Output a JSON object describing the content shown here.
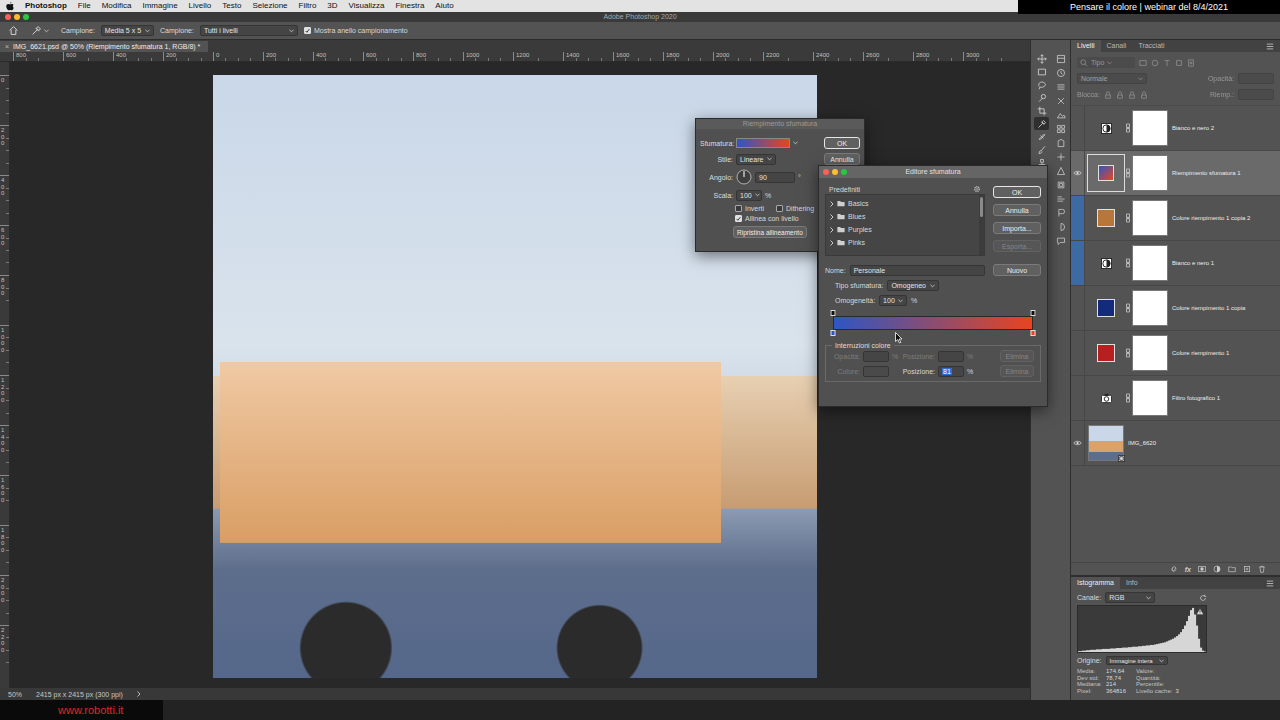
{
  "menubar": {
    "items": [
      {
        "label": "Photoshop",
        "bold": true
      },
      {
        "label": "File",
        "bold": false
      },
      {
        "label": "Modifica",
        "bold": false
      },
      {
        "label": "Immagine",
        "bold": false
      },
      {
        "label": "Livello",
        "bold": false
      },
      {
        "label": "Testo",
        "bold": false
      },
      {
        "label": "Selezione",
        "bold": false
      },
      {
        "label": "Filtro",
        "bold": false
      },
      {
        "label": "3D",
        "bold": false
      },
      {
        "label": "Visualizza",
        "bold": false
      },
      {
        "label": "Finestra",
        "bold": false
      },
      {
        "label": "Aiuto",
        "bold": false
      }
    ],
    "banner": "Pensare il colore | webinar del 8/4/2021"
  },
  "window": {
    "title": "Adobe Photoshop 2020"
  },
  "options_bar": {
    "sample_size_label": "Campione:",
    "sample_size": "Media 5 x 5",
    "sample_label": "Campione:",
    "sample": "Tutti i livelli",
    "ring": {
      "label": "Mostra anello campionamento",
      "checked": true
    }
  },
  "document": {
    "tab": {
      "close": "×",
      "title": "IMG_6621.psd @ 50% (Riempimento sfumatura 1, RGB/8) *",
      "selected": true
    },
    "rulers": {
      "top": [
        "800",
        "600",
        "400",
        "200",
        "0",
        "200",
        "400",
        "600",
        "800",
        "1000",
        "1200",
        "1400",
        "1600",
        "1800",
        "2000",
        "2200",
        "2400",
        "2600",
        "2800",
        "3000"
      ],
      "left": [
        "0",
        "200",
        "400",
        "600",
        "800",
        "1000",
        "1200",
        "1400",
        "1600",
        "1800",
        "2000",
        "2200"
      ]
    },
    "status": {
      "zoom": "50%",
      "size": "2415 px x 2415 px (300 ppi)"
    }
  },
  "watermark": "www.robotti.it",
  "tools": [
    {
      "selected": false
    },
    {
      "selected": false
    },
    {
      "selected": false
    },
    {
      "selected": false
    },
    {
      "selected": false
    },
    {
      "selected": true
    },
    {
      "selected": false
    },
    {
      "selected": false
    },
    {
      "selected": false
    },
    {
      "selected": false
    },
    {
      "selected": false
    },
    {
      "selected": false
    },
    {
      "selected": false
    },
    {
      "selected": false
    },
    {
      "selected": false
    },
    {
      "selected": false
    },
    {
      "selected": false
    },
    {
      "selected": false
    },
    {
      "selected": false
    },
    {
      "selected": false
    }
  ],
  "fill_dialog": {
    "title": "Riempimento sfumatura",
    "active": false,
    "gradient_label": "Sfumatura:",
    "style_label": "Stile:",
    "style": "Lineare",
    "angle_label": "Angolo:",
    "angle": "90",
    "angle_unit": "°",
    "scale_label": "Scala:",
    "scale": "100",
    "scale_unit": "%",
    "checkboxes": [
      {
        "label": "Inverti",
        "checked": false
      },
      {
        "label": "Dithering",
        "checked": false
      },
      {
        "label": "Allinea con livello",
        "checked": true
      }
    ],
    "reset_button": "Ripristina allineamento",
    "buttons": [
      {
        "label": "OK",
        "default": true
      },
      {
        "label": "Annulla",
        "default": false
      }
    ]
  },
  "gradient_editor": {
    "title": "Editore sfumatura",
    "active": true,
    "presets_label": "Predefiniti",
    "folders": [
      {
        "label": "Basics",
        "expanded": false
      },
      {
        "label": "Blues",
        "expanded": false
      },
      {
        "label": "Purples",
        "expanded": false
      },
      {
        "label": "Pinks",
        "expanded": false
      }
    ],
    "buttons": [
      {
        "label": "OK",
        "default": true,
        "disabled": false
      },
      {
        "label": "Annulla",
        "default": false,
        "disabled": false
      },
      {
        "label": "Importa...",
        "default": false,
        "disabled": false
      },
      {
        "label": "Esporta...",
        "default": false,
        "disabled": true
      }
    ],
    "name_label": "Nome:",
    "name": "Personale",
    "new_button": "Nuovo",
    "type_label": "Tipo sfumatura:",
    "type": "Omogeneo",
    "smoothness_label": "Omogeneità:",
    "smoothness": "100",
    "smoothness_unit": "%",
    "opacity_stops": [
      {
        "location": 0,
        "selected": false
      },
      {
        "location": 1,
        "selected": false
      }
    ],
    "color_stops": [
      {
        "location": 0,
        "color": "#2e56c4",
        "selected": false
      },
      {
        "location": 1,
        "color": "#e8441f",
        "selected": false
      }
    ],
    "stops_group": {
      "title": "Interruzioni colore",
      "opacity_row": {
        "label": "Opacità:",
        "value": "",
        "unit": "%",
        "position_label": "Posizione:",
        "position": "",
        "position_unit": "%",
        "delete": "Elimina",
        "disabled": true
      },
      "color_row": {
        "label": "Colore:",
        "label_disabled": true,
        "position_label": "Posizione:",
        "position": "81",
        "position_highlighted": true,
        "position_unit": "%",
        "delete": "Elimina",
        "delete_disabled": true
      }
    }
  },
  "layers_panel": {
    "tabs": [
      {
        "label": "Livelli",
        "selected": true
      },
      {
        "label": "Canali",
        "selected": false
      },
      {
        "label": "Tracciati",
        "selected": false
      }
    ],
    "controls_disabled": true,
    "filter_placeholder": "Tipo",
    "blend_mode": "Normale",
    "opacity_label": "Opacità:",
    "lock_label": "Blocca:",
    "fill_label": "Riemp.:",
    "layers": [
      {
        "name": "Bianco e nero 2",
        "kind": "black-white",
        "visible": false,
        "selected": false,
        "mask": true,
        "tag": null
      },
      {
        "name": "Riempimento sfumatura 1",
        "kind": "gradient",
        "visible": true,
        "selected": true,
        "mask": true,
        "tag": null
      },
      {
        "name": "Colore riempimento 1 copia 2",
        "kind": "fill",
        "color": "#b8773a",
        "visible": false,
        "selected": false,
        "mask": true,
        "tag": "#3d6aa3"
      },
      {
        "name": "Bianco e nero 1",
        "kind": "black-white",
        "visible": false,
        "selected": false,
        "mask": true,
        "tag": "#3d6aa3"
      },
      {
        "name": "Colore riempimento 1 copia",
        "kind": "fill",
        "color": "#142a7a",
        "visible": false,
        "selected": false,
        "mask": true,
        "tag": null
      },
      {
        "name": "Colore riempimento 1",
        "kind": "fill",
        "color": "#b81f1f",
        "visible": false,
        "selected": false,
        "mask": true,
        "tag": null
      },
      {
        "name": "Filtro fotografico 1",
        "kind": "photo-filter",
        "visible": false,
        "selected": false,
        "mask": true,
        "tag": null
      },
      {
        "name": "IMG_6620",
        "kind": "image",
        "visible": true,
        "selected": false,
        "mask": false,
        "tag": null
      }
    ],
    "fx_label": "fx"
  },
  "histogram_panel": {
    "tabs": [
      {
        "label": "Istogramma",
        "selected": true
      },
      {
        "label": "Info",
        "selected": false
      }
    ],
    "channel_label": "Canale:",
    "channel": "RGB",
    "values": [
      2,
      2,
      3,
      3,
      4,
      4,
      5,
      5,
      5,
      6,
      6,
      6,
      7,
      7,
      7,
      7,
      8,
      8,
      8,
      9,
      9,
      9,
      10,
      10,
      10,
      11,
      11,
      12,
      12,
      12,
      13,
      13,
      14,
      14,
      15,
      15,
      16,
      16,
      17,
      18,
      19,
      20,
      21,
      22,
      24,
      26,
      28,
      30,
      33,
      36,
      40,
      45,
      52,
      60,
      70,
      82,
      95,
      100,
      85,
      60,
      30,
      10,
      3,
      1
    ],
    "source_label": "Origine:",
    "source": "Immagine intera",
    "stats_left": [
      {
        "label": "Media:",
        "value": "174,64"
      },
      {
        "label": "Dev std:",
        "value": "78,74"
      },
      {
        "label": "Mediana:",
        "value": "214"
      },
      {
        "label": "Pixel:",
        "value": "364816"
      }
    ],
    "stats_right": [
      {
        "label": "Valore:",
        "value": ""
      },
      {
        "label": "Quantità:",
        "value": ""
      },
      {
        "label": "Percentile:",
        "value": ""
      },
      {
        "label": "Livello cache:",
        "value": "3"
      }
    ]
  }
}
